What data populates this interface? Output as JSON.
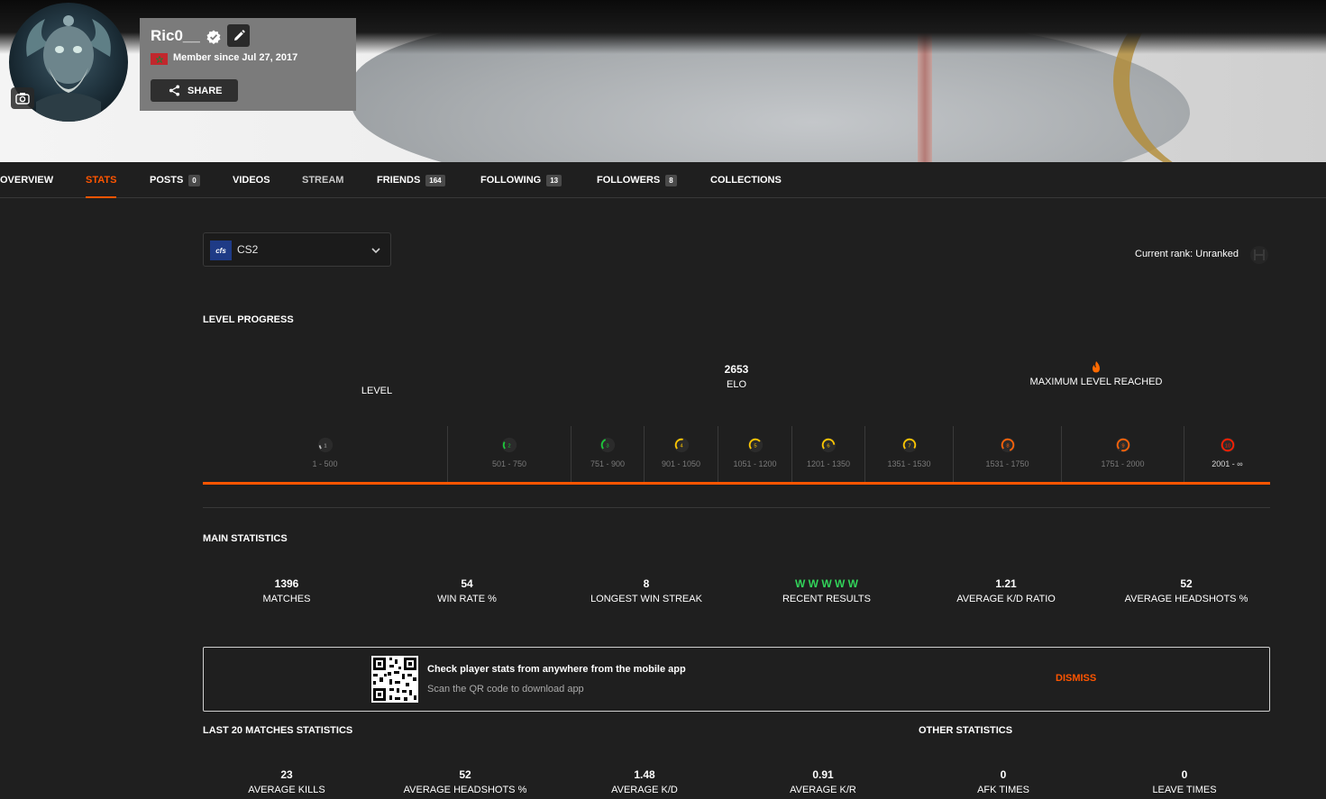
{
  "profile": {
    "username": "Ric0__",
    "member_since": "Member since Jul 27, 2017",
    "share_label": "SHARE",
    "flag_color": "#c1272d"
  },
  "tabs": [
    {
      "label": "OVERVIEW"
    },
    {
      "label": "STATS",
      "active": true
    },
    {
      "label": "POSTS",
      "count": "0"
    },
    {
      "label": "VIDEOS"
    },
    {
      "label": "STREAM"
    },
    {
      "label": "FRIENDS",
      "count": "164"
    },
    {
      "label": "FOLLOWING",
      "count": "13"
    },
    {
      "label": "FOLLOWERS",
      "count": "8"
    },
    {
      "label": "COLLECTIONS"
    }
  ],
  "game_select": {
    "logo_text": "cfs",
    "value": "CS2"
  },
  "current_rank": "Current rank: Unranked",
  "level_progress": {
    "title": "LEVEL PROGRESS",
    "level_label": "LEVEL",
    "elo_value": "2653",
    "elo_label": "ELO",
    "max_label": "MAXIMUM LEVEL REACHED",
    "levels": [
      {
        "level": "1",
        "range": "1 - 500",
        "color": "#bdbdbd"
      },
      {
        "level": "2",
        "range": "501 - 750",
        "color": "#1ccb3a"
      },
      {
        "level": "3",
        "range": "751 - 900",
        "color": "#1ccb3a"
      },
      {
        "level": "4",
        "range": "901 - 1050",
        "color": "#ffc700"
      },
      {
        "level": "5",
        "range": "1051 - 1200",
        "color": "#ffc700"
      },
      {
        "level": "6",
        "range": "1201 - 1350",
        "color": "#ffc700"
      },
      {
        "level": "7",
        "range": "1351 - 1530",
        "color": "#ffc700"
      },
      {
        "level": "8",
        "range": "1531 - 1750",
        "color": "#ff6309"
      },
      {
        "level": "9",
        "range": "1751 - 2000",
        "color": "#ff6309"
      },
      {
        "level": "10",
        "range": "2001 - ∞",
        "color": "#fe1f00",
        "current": true
      }
    ],
    "accent": "#ff5500"
  },
  "main_statistics": {
    "title": "MAIN STATISTICS",
    "items": [
      {
        "value": "1396",
        "label": "MATCHES"
      },
      {
        "value": "54",
        "label": "WIN RATE %"
      },
      {
        "value": "8",
        "label": "LONGEST WIN STREAK"
      },
      {
        "value": "W W W W W",
        "label": "RECENT RESULTS",
        "color": "#32d35a"
      },
      {
        "value": "1.21",
        "label": "AVERAGE K/D RATIO"
      },
      {
        "value": "52",
        "label": "AVERAGE HEADSHOTS %"
      }
    ]
  },
  "app_banner": {
    "title": "Check player stats from anywhere from the mobile app",
    "subtitle": "Scan the QR code to download app",
    "dismiss_label": "DISMISS"
  },
  "last20": {
    "title": "LAST 20 MATCHES STATISTICS",
    "items": [
      {
        "value": "23",
        "label": "AVERAGE KILLS"
      },
      {
        "value": "52",
        "label": "AVERAGE HEADSHOTS %"
      },
      {
        "value": "1.48",
        "label": "AVERAGE K/D"
      },
      {
        "value": "0.91",
        "label": "AVERAGE K/R"
      }
    ]
  },
  "other_statistics": {
    "title": "OTHER STATISTICS",
    "items": [
      {
        "value": "0",
        "label": "AFK TIMES"
      },
      {
        "value": "0",
        "label": "LEAVE TIMES"
      }
    ]
  }
}
